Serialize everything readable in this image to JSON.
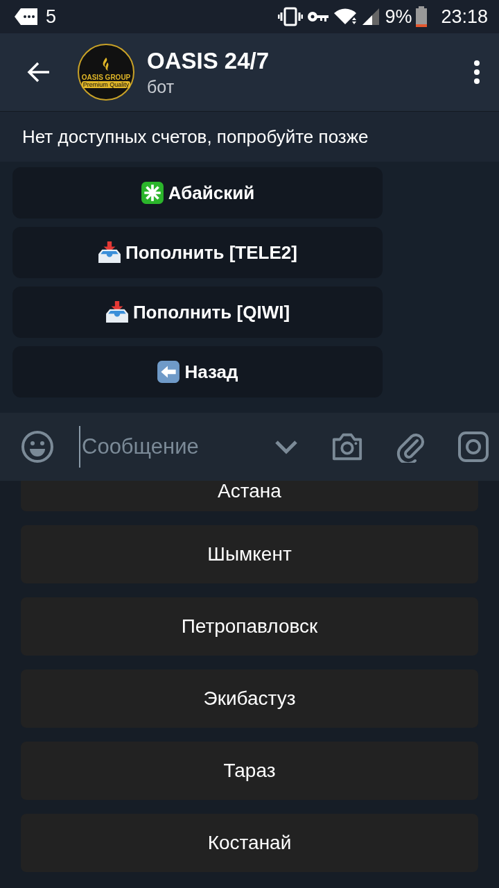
{
  "status_bar": {
    "notification_count": "5",
    "battery": "9%",
    "time": "23:18"
  },
  "header": {
    "title": "OASIS 24/7",
    "subtitle": "бот",
    "avatar_text": "OASIS GROUP",
    "avatar_tagline": "Premium Quality"
  },
  "notice": "Нет доступных счетов, попробуйте позже",
  "inline_buttons": [
    {
      "kind": "asterisk",
      "label": "Абайский"
    },
    {
      "kind": "inbox",
      "label": "Пополнить [TELE2]"
    },
    {
      "kind": "inbox",
      "label": "Пополнить [QIWI]"
    },
    {
      "kind": "back",
      "label": "Назад"
    }
  ],
  "composer": {
    "placeholder": "Сообщение"
  },
  "keyboard": [
    "Астана",
    "Шымкент",
    "Петропавловск",
    "Экибастуз",
    "Тараз",
    "Костанай"
  ]
}
